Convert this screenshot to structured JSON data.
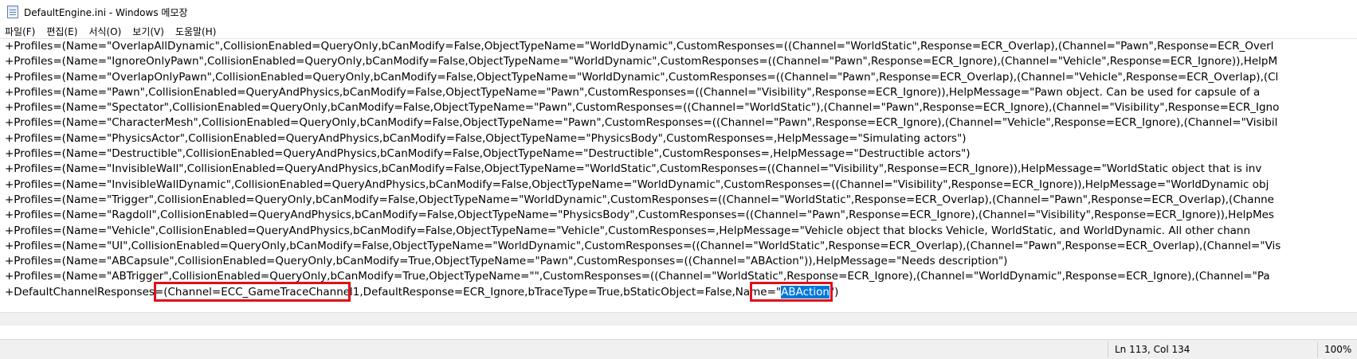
{
  "window": {
    "title": "DefaultEngine.ini - Windows 메모장"
  },
  "menu": [
    "파일(F)",
    "편집(E)",
    "서식(O)",
    "보기(V)",
    "도움말(H)"
  ],
  "lines": [
    "+Profiles=(Name=\"OverlapAllDynamic\",CollisionEnabled=QueryOnly,bCanModify=False,ObjectTypeName=\"WorldDynamic\",CustomResponses=((Channel=\"WorldStatic\",Response=ECR_Overlap),(Channel=\"Pawn\",Response=ECR_Overl",
    "+Profiles=(Name=\"IgnoreOnlyPawn\",CollisionEnabled=QueryOnly,bCanModify=False,ObjectTypeName=\"WorldDynamic\",CustomResponses=((Channel=\"Pawn\",Response=ECR_Ignore),(Channel=\"Vehicle\",Response=ECR_Ignore)),HelpM",
    "+Profiles=(Name=\"OverlapOnlyPawn\",CollisionEnabled=QueryOnly,bCanModify=False,ObjectTypeName=\"WorldDynamic\",CustomResponses=((Channel=\"Pawn\",Response=ECR_Overlap),(Channel=\"Vehicle\",Response=ECR_Overlap),(Cl",
    "+Profiles=(Name=\"Pawn\",CollisionEnabled=QueryAndPhysics,bCanModify=False,ObjectTypeName=\"Pawn\",CustomResponses=((Channel=\"Visibility\",Response=ECR_Ignore)),HelpMessage=\"Pawn object. Can be used for capsule of a",
    "+Profiles=(Name=\"Spectator\",CollisionEnabled=QueryOnly,bCanModify=False,ObjectTypeName=\"Pawn\",CustomResponses=((Channel=\"WorldStatic\"),(Channel=\"Pawn\",Response=ECR_Ignore),(Channel=\"Visibility\",Response=ECR_Igno",
    "+Profiles=(Name=\"CharacterMesh\",CollisionEnabled=QueryOnly,bCanModify=False,ObjectTypeName=\"Pawn\",CustomResponses=((Channel=\"Pawn\",Response=ECR_Ignore),(Channel=\"Vehicle\",Response=ECR_Ignore),(Channel=\"Visibil",
    "+Profiles=(Name=\"PhysicsActor\",CollisionEnabled=QueryAndPhysics,bCanModify=False,ObjectTypeName=\"PhysicsBody\",CustomResponses=,HelpMessage=\"Simulating actors\")",
    "+Profiles=(Name=\"Destructible\",CollisionEnabled=QueryAndPhysics,bCanModify=False,ObjectTypeName=\"Destructible\",CustomResponses=,HelpMessage=\"Destructible actors\")",
    "+Profiles=(Name=\"InvisibleWall\",CollisionEnabled=QueryAndPhysics,bCanModify=False,ObjectTypeName=\"WorldStatic\",CustomResponses=((Channel=\"Visibility\",Response=ECR_Ignore)),HelpMessage=\"WorldStatic object that is inv",
    "+Profiles=(Name=\"InvisibleWallDynamic\",CollisionEnabled=QueryAndPhysics,bCanModify=False,ObjectTypeName=\"WorldDynamic\",CustomResponses=((Channel=\"Visibility\",Response=ECR_Ignore)),HelpMessage=\"WorldDynamic obj",
    "+Profiles=(Name=\"Trigger\",CollisionEnabled=QueryOnly,bCanModify=False,ObjectTypeName=\"WorldDynamic\",CustomResponses=((Channel=\"WorldStatic\",Response=ECR_Overlap),(Channel=\"Pawn\",Response=ECR_Overlap),(Channe",
    "+Profiles=(Name=\"Ragdoll\",CollisionEnabled=QueryAndPhysics,bCanModify=False,ObjectTypeName=\"PhysicsBody\",CustomResponses=((Channel=\"Pawn\",Response=ECR_Ignore),(Channel=\"Visibility\",Response=ECR_Ignore)),HelpMes",
    "+Profiles=(Name=\"Vehicle\",CollisionEnabled=QueryAndPhysics,bCanModify=False,ObjectTypeName=\"Vehicle\",CustomResponses=,HelpMessage=\"Vehicle object that blocks Vehicle, WorldStatic, and WorldDynamic. All other chann",
    "+Profiles=(Name=\"UI\",CollisionEnabled=QueryOnly,bCanModify=False,ObjectTypeName=\"WorldDynamic\",CustomResponses=((Channel=\"WorldStatic\",Response=ECR_Overlap),(Channel=\"Pawn\",Response=ECR_Overlap),(Channel=\"Vis",
    "+Profiles=(Name=\"ABCapsule\",CollisionEnabled=QueryOnly,bCanModify=True,ObjectTypeName=\"Pawn\",CustomResponses=((Channel=\"ABAction\")),HelpMessage=\"Needs description\")",
    "+Profiles=(Name=\"ABTrigger\",CollisionEnabled=QueryOnly,bCanModify=True,ObjectTypeName=\"\",CustomResponses=((Channel=\"WorldStatic\",Response=ECR_Ignore),(Channel=\"WorldDynamic\",Response=ECR_Ignore),(Channel=\"Pa"
  ],
  "last_line": {
    "before": "+DefaultChannelResponses=(Channel=ECC_GameTraceChannel1,DefaultResponse=ECR_Ignore,bTraceType=True,bStaticObject=False,Name=\"",
    "selected": "ABAction",
    "after": "\")"
  },
  "status": {
    "position": "Ln 113, Col 134",
    "zoom": "100%"
  }
}
